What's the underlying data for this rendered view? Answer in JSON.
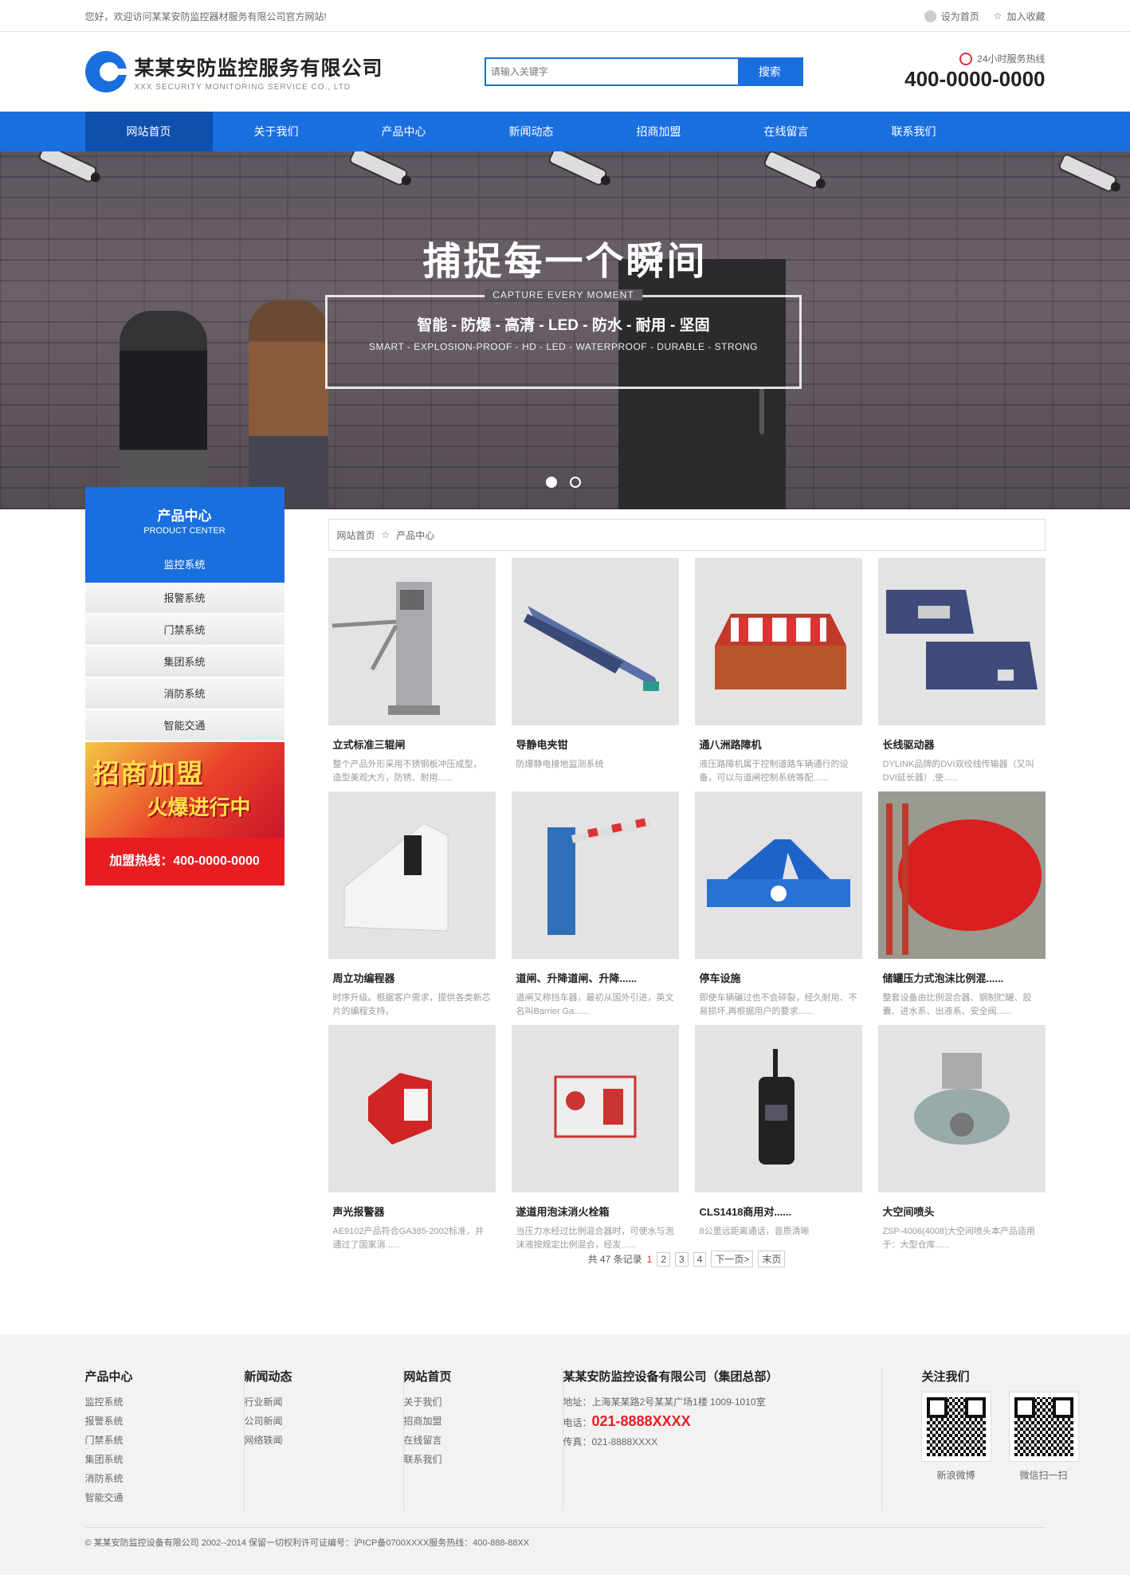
{
  "topbar": {
    "welcome": "您好，欢迎访问某某安防监控器材服务有限公司官方网站!",
    "set_home": "设为首页",
    "add_fav": "加入收藏"
  },
  "header": {
    "company": "某某安防监控服务有限公司",
    "company_en": "XXX SECURITY MONITORING SERVICE CO., LTD",
    "search_placeholder": "请输入关键字",
    "search_button": "搜索",
    "hotline_label": "24小时服务热线",
    "hotline": "400-0000-0000"
  },
  "nav": [
    "网站首页",
    "关于我们",
    "产品中心",
    "新闻动态",
    "招商加盟",
    "在线留言",
    "联系我们"
  ],
  "banner": {
    "title": "捕捉每一个瞬间",
    "caption": "CAPTURE EVERY MOMENT",
    "features": "智能 - 防爆 - 高清 - LED - 防水 - 耐用 - 坚固",
    "features_en": "SMART - EXPLOSION-PROOF - HD - LED - WATERPROOF - DURABLE - STRONG"
  },
  "sidebar": {
    "title": "产品中心",
    "title_en": "PRODUCT CENTER",
    "current": "监控系统",
    "items": [
      "报警系统",
      "门禁系统",
      "集团系统",
      "消防系统",
      "智能交通"
    ],
    "promo_line1": "招商加盟",
    "promo_line2": "火爆进行中",
    "promo_hotline": "加盟热线：400-0000-0000"
  },
  "breadcrumb": {
    "home": "网站首页",
    "current": "产品中心"
  },
  "products": [
    {
      "name": "立式标准三辊闸",
      "desc": "整个产品外形采用不锈钢板冲压成型， 造型美观大方，防锈、耐用......"
    },
    {
      "name": "导静电夹钳",
      "desc": "防爆静电接地监测系统"
    },
    {
      "name": "通八洲路障机",
      "desc": "液压路障机属于控制道路车辆通行的设备，可以与道闸控制系统等配......"
    },
    {
      "name": "长线驱动器",
      "desc": "DYLINK品牌的DVI双绞线传输器（又叫DVI延长器）,使......"
    },
    {
      "name": "周立功编程器",
      "desc": "时序升级。根据客户需求，提供各类新芯片的编程支持。"
    },
    {
      "name": "道闸、升降道闸、升降......",
      "desc": "道闸又称挡车器，最初从国外引进，英文名叫Barrier Ga......"
    },
    {
      "name": "停车设施",
      "desc": "即使车辆碾过也不会碎裂，经久耐用、不易损坏,再根据用户的要求......"
    },
    {
      "name": "储罐压力式泡沫比例混......",
      "desc": "整套设备由比例混合器、钢制贮罐、胶囊、进水系、出液系、安全阀......"
    },
    {
      "name": "声光报警器",
      "desc": "AE9102产品符合GA385-2002标准，并通过了国家消......"
    },
    {
      "name": "遂道用泡沫消火栓箱",
      "desc": "当压力水经过比例混合器时，可使水与泡沫液按规定比例混合，经发......"
    },
    {
      "name": "CLS1418商用对......",
      "desc": "8公里远距离通话，音质清晰"
    },
    {
      "name": "大空间喷头",
      "desc": "ZSP-4006(4008)大空间喷头本产品适用于：大型仓库......"
    }
  ],
  "pager": {
    "total": "共 47 条记录",
    "pages": [
      "1",
      "2",
      "3",
      "4"
    ],
    "next": "下一页>",
    "last": "末页"
  },
  "footer": {
    "col1": {
      "title": "产品中心",
      "items": [
        "监控系统",
        "报警系统",
        "门禁系统",
        "集团系统",
        "消防系统",
        "智能交通"
      ]
    },
    "col2": {
      "title": "新闻动态",
      "items": [
        "行业新闻",
        "公司新闻",
        "网络轶闻"
      ]
    },
    "col3": {
      "title": "网站首页",
      "items": [
        "关于我们",
        "招商加盟",
        "在线留言",
        "联系我们"
      ]
    },
    "company": {
      "title": "某某安防监控设备有限公司（集团总部）",
      "address": "地址：上海某某路2号某某广场1楼 1009-1010室",
      "tel_label": "电话：",
      "tel": "021-8888XXXX",
      "fax": "传真：021-8888XXXX"
    },
    "follow": {
      "title": "关注我们",
      "qr1": "新浪微博",
      "qr2": "微信扫一扫"
    },
    "copyright": "© 某某安防监控设备有限公司 2002--2014 保留一切权利许可证编号：沪ICP备0700XXXX服务热线：400-888-88XX"
  }
}
